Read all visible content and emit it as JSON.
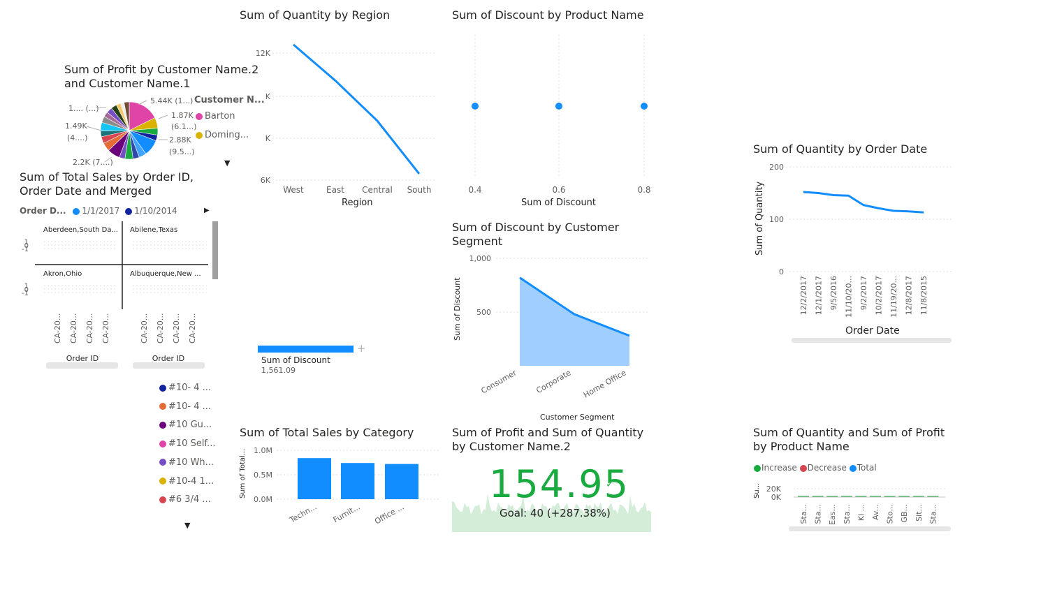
{
  "region_chart": {
    "title": "Sum of Quantity by Region",
    "xlabel": "Region",
    "y_ticks": [
      "12K",
      "K",
      "K",
      "6K"
    ],
    "categories": [
      "West",
      "East",
      "Central",
      "South"
    ],
    "values": [
      12400,
      10700,
      8800,
      6300
    ],
    "ylim": [
      6000,
      12000
    ],
    "color": "#118DFF"
  },
  "discount_product_chart": {
    "title": "Sum of Discount by Product Name",
    "xlabel": "Sum of Discount",
    "x_ticks": [
      "0.4",
      "0.6",
      "0.8"
    ],
    "x": [
      0.4,
      0.6,
      0.8
    ],
    "color": "#118DFF"
  },
  "pie_chart": {
    "title": "Sum of Profit by Customer Name.2 and Customer Name.1",
    "legend_title": "Customer N...",
    "legend_items": [
      {
        "label": "Barton",
        "color": "#E044A7"
      },
      {
        "label": "Doming...",
        "color": "#D9B300"
      }
    ],
    "labels": [
      "5.44K (1...)",
      "1.87K",
      "(6.1...)",
      "2.88K",
      "(9.5...)",
      "2.2K (7....)",
      "1.49K",
      "(4....)",
      "1.... (...)"
    ],
    "slice_colors": [
      "#E044A7",
      "#D9B300",
      "#1AAB40",
      "#12239E",
      "#118DFF",
      "#41A4FF",
      "#3049AD",
      "#1AAB40",
      "#744EC2",
      "#6B007B",
      "#E66C37",
      "#D64550",
      "#197278",
      "#15C6F4",
      "#8C8C8C",
      "#A66999",
      "#744EC2",
      "#254117",
      "#F5C869",
      "#eeeeee",
      "#6F4E37"
    ],
    "slice_values": [
      5.44,
      1.87,
      1.2,
      1.0,
      2.88,
      1.3,
      1.1,
      1.4,
      1.0,
      2.2,
      1.5,
      1.2,
      1.0,
      1.49,
      1.1,
      0.9,
      1.0,
      1.0,
      0.8,
      0.6,
      0.9
    ]
  },
  "small_multiples": {
    "title": "Sum of Total Sales by Order ID, Order Date and Merged",
    "legend_label": "Order D...",
    "legend_items": [
      {
        "label": "1/1/2017",
        "color": "#118DFF"
      },
      {
        "label": "1/10/2014",
        "color": "#12239E"
      }
    ],
    "panels": [
      "Aberdeen,South Da...",
      "Abilene,Texas",
      "Akron,Ohio",
      "Albuquerque,New ..."
    ],
    "y_ticks": [
      "1",
      "0",
      "-1"
    ],
    "x_ticks": [
      "CA-20...",
      "CA-20...",
      "CA-20...",
      "CA-20..."
    ],
    "xlabel": "Order ID"
  },
  "legend_list": {
    "items": [
      {
        "label": "#10- 4 ...",
        "color": "#12239E"
      },
      {
        "label": "#10- 4 ...",
        "color": "#E66C37"
      },
      {
        "label": "#10 Gu...",
        "color": "#6B007B"
      },
      {
        "label": "#10 Self...",
        "color": "#E044A7"
      },
      {
        "label": "#10 Wh...",
        "color": "#744EC2"
      },
      {
        "label": "#10-4 1...",
        "color": "#D9B300"
      },
      {
        "label": "#6 3/4 ...",
        "color": "#D64550"
      }
    ]
  },
  "discount_card": {
    "label": "Sum of Discount",
    "value": "1,561.09",
    "color": "#118DFF"
  },
  "segment_chart": {
    "title": "Sum of Discount by Customer Segment",
    "xlabel": "Customer Segment",
    "ylabel": "Sum of Discount",
    "y_ticks": [
      "1,000",
      "500"
    ],
    "categories": [
      "Consumer",
      "Corporate",
      "Home Office"
    ],
    "values": [
      820,
      480,
      280
    ],
    "ylim": [
      0,
      1000
    ],
    "color": "#118DFF"
  },
  "order_date_chart": {
    "title": "Sum of Quantity by Order Date",
    "xlabel": "Order Date",
    "ylabel": "Sum of Quantity",
    "y_ticks": [
      "200",
      "100",
      "0"
    ],
    "categories": [
      "12/2/2017",
      "12/1/2017",
      "9/5/2016",
      "11/10/20...",
      "9/2/2017",
      "10/2/2017",
      "11/19/20...",
      "12/8/2017",
      "11/8/2015"
    ],
    "values": [
      152,
      150,
      146,
      145,
      127,
      121,
      116,
      115,
      113
    ],
    "ylim": [
      0,
      200
    ],
    "color": "#118DFF"
  },
  "category_chart": {
    "title": "Sum of Total Sales by Category",
    "ylabel": "Sum of Total...",
    "y_ticks": [
      "1.0M",
      "0.5M",
      "0.0M"
    ],
    "categories": [
      "Techn...",
      "Furnit...",
      "Office ..."
    ],
    "values": [
      0.84,
      0.74,
      0.72
    ],
    "ylim": [
      0,
      1.0
    ],
    "color": "#118DFF"
  },
  "kpi": {
    "title": "Sum of Profit and Sum of Quantity by Customer Name.2",
    "value": "154.95",
    "goal": "Goal: 40 (+287.38%)",
    "color": "#1AAB40"
  },
  "waterfall": {
    "title": "Sum of Quantity and Sum of Profit by Product Name",
    "legend_items": [
      {
        "label": "Increase",
        "color": "#1AAB40"
      },
      {
        "label": "Decrease",
        "color": "#D64550"
      },
      {
        "label": "Total",
        "color": "#118DFF"
      }
    ],
    "ylabel": "Su...",
    "y_ticks": [
      "20K",
      "0K"
    ],
    "x_ticks": [
      "Sta...",
      "Sta...",
      "Eas...",
      "Sta...",
      "Kl ...",
      "Av...",
      "Sto...",
      "GB...",
      "Sit...",
      "Sta..."
    ]
  }
}
